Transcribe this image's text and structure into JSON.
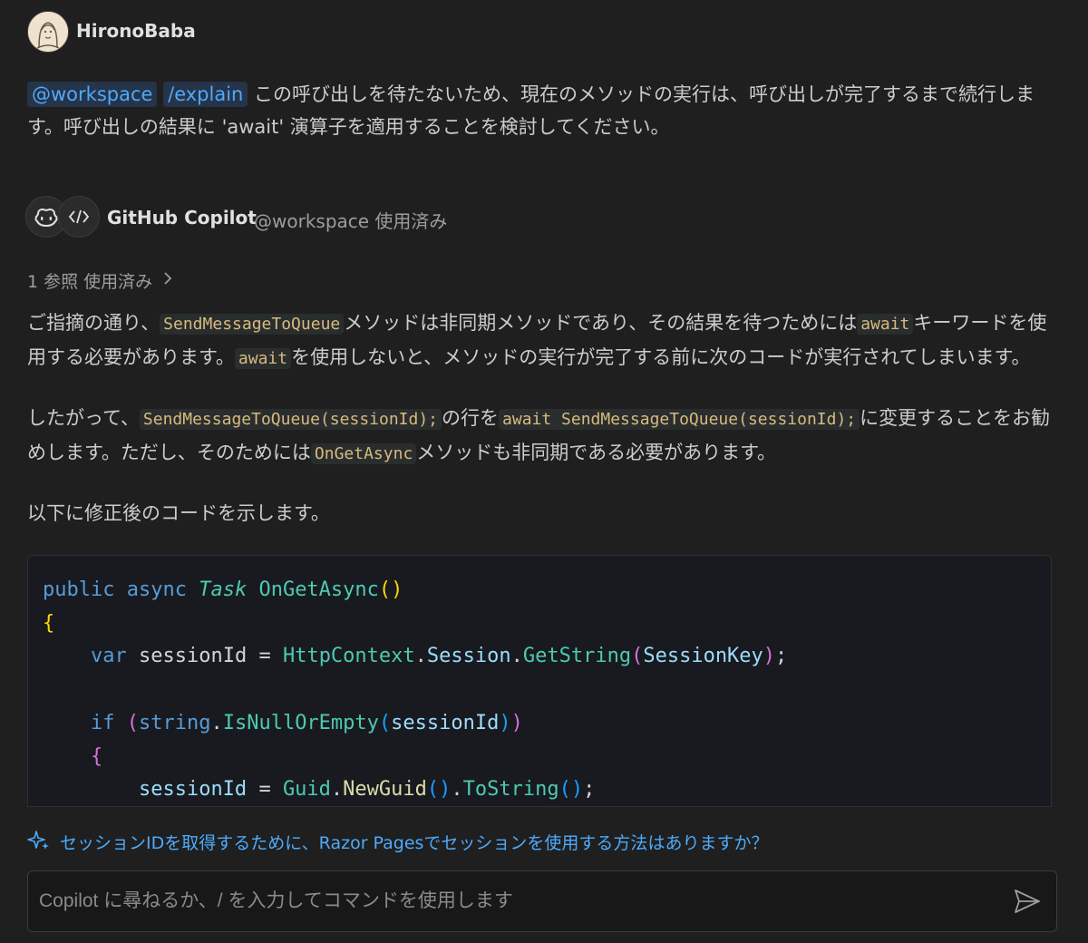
{
  "user": {
    "name": "HironoBaba"
  },
  "user_message": {
    "chips": [
      "@workspace",
      "/explain"
    ],
    "text": "この呼び出しを待たないため、現在のメソッドの実行は、呼び出しが完了するまで続行します。呼び出しの結果に 'await' 演算子を適用することを検討してください。"
  },
  "assistant": {
    "name": "GitHub Copilot",
    "subtitle": "@workspace 使用済み",
    "refs": "1 参照 使用済み"
  },
  "response": {
    "p1": {
      "a": "ご指摘の通り、",
      "code1": "SendMessageToQueue",
      "b": "メソッドは非同期メソッドであり、その結果を待つためには",
      "code2": "await",
      "c": "キーワードを使用する必要があります。",
      "code3": "await",
      "d": "を使用しないと、メソッドの実行が完了する前に次のコードが実行されてしまいます。"
    },
    "p2": {
      "a": "したがって、",
      "code1": "SendMessageToQueue(sessionId);",
      "b": "の行を",
      "code2": "await SendMessageToQueue(sessionId);",
      "c": "に変更することをお勧めします。ただし、そのためには",
      "code3": "OnGetAsync",
      "d": "メソッドも非同期である必要があります。"
    },
    "p3": "以下に修正後のコードを示します。"
  },
  "code": {
    "l1": {
      "kw1": "public",
      "kw2": "async",
      "type": "Task",
      "fn": "OnGetAsync",
      "parens": "()"
    },
    "l2": {
      "brace": "{"
    },
    "l3": {
      "kw": "var",
      "name": "sessionId",
      "op": "=",
      "obj": "HttpContext",
      "prop": "Session",
      "method": "GetString",
      "arg": "SessionKey",
      "end": ";"
    },
    "l4": {
      "kw": "if",
      "type": "string",
      "method": "IsNullOrEmpty",
      "arg": "sessionId"
    },
    "l5": {
      "brace": "{"
    },
    "l6": {
      "name": "sessionId",
      "op": "=",
      "obj": "Guid",
      "method": "NewGuid",
      "method2": "ToString",
      "end": ";"
    }
  },
  "suggestion": "セッションIDを取得するために、Razor Pagesでセッションを使用する方法はありますか？",
  "input": {
    "placeholder": "Copilot に尋ねるか、/ を入力してコマンドを使用します",
    "value": ""
  },
  "icons": {
    "avatar": "user-avatar",
    "copilot": "copilot-icon",
    "code": "code-icon",
    "chevron": "chevron-right-icon",
    "sparkle": "sparkle-icon",
    "send": "send-icon"
  }
}
